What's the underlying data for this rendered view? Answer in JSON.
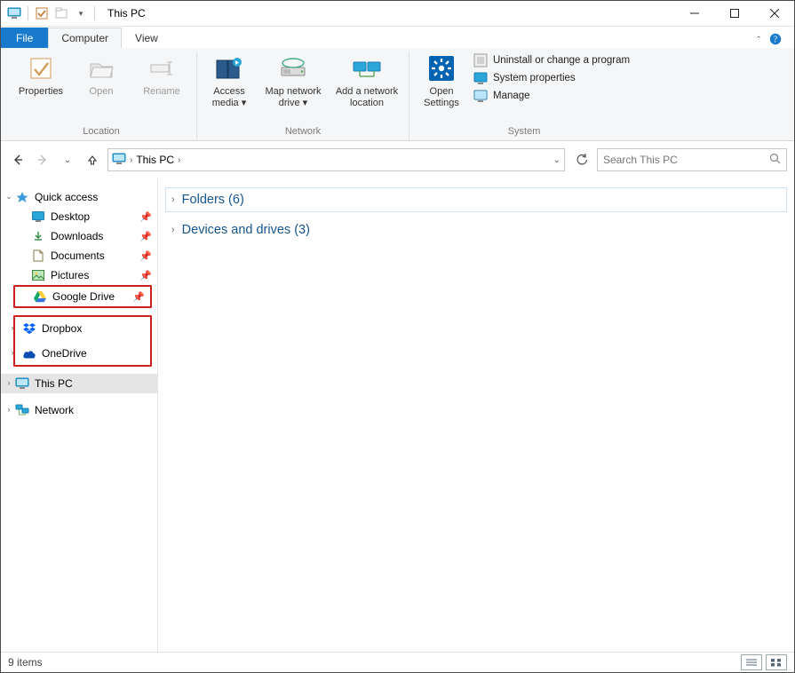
{
  "window": {
    "title": "This PC"
  },
  "tabs": {
    "file": "File",
    "computer": "Computer",
    "view": "View"
  },
  "ribbon": {
    "location": {
      "label": "Location",
      "properties": "Properties",
      "open": "Open",
      "rename": "Rename"
    },
    "network": {
      "label": "Network",
      "access_media": "Access media ▾",
      "map_drive": "Map network drive ▾",
      "add_loc": "Add a network location"
    },
    "system": {
      "label": "System",
      "open_settings": "Open Settings",
      "uninstall": "Uninstall or change a program",
      "props": "System properties",
      "manage": "Manage"
    }
  },
  "address": {
    "location": "This PC",
    "search_placeholder": "Search This PC"
  },
  "tree": {
    "quick_access": "Quick access",
    "desktop": "Desktop",
    "downloads": "Downloads",
    "documents": "Documents",
    "pictures": "Pictures",
    "google_drive": "Google Drive",
    "dropbox": "Dropbox",
    "onedrive": "OneDrive",
    "this_pc": "This PC",
    "network": "Network"
  },
  "content": {
    "folders": "Folders (6)",
    "devices": "Devices and drives (3)"
  },
  "status": {
    "items": "9 items"
  }
}
